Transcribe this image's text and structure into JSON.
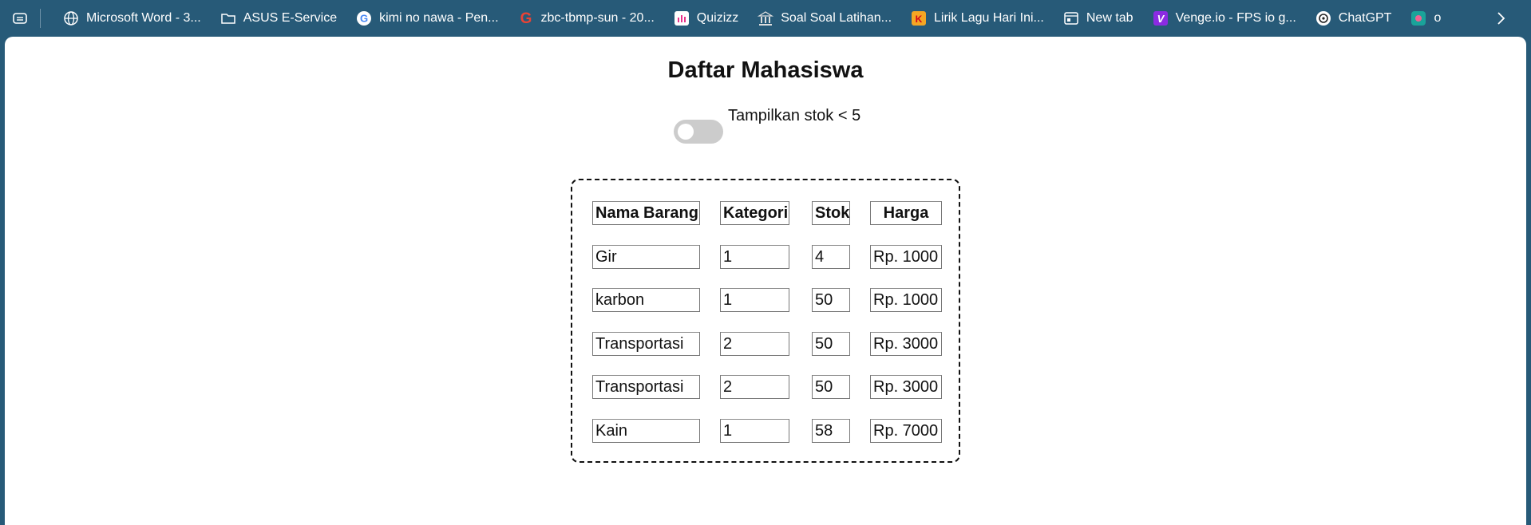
{
  "bookmarks": [
    {
      "label": "Microsoft Word - 3...",
      "icon": "globe-icon"
    },
    {
      "label": "ASUS E-Service",
      "icon": "folder-icon"
    },
    {
      "label": "kimi no nawa - Pen...",
      "icon": "google-icon"
    },
    {
      "label": "zbc-tbmp-sun - 20...",
      "icon": "google-icon"
    },
    {
      "label": "Quizizz",
      "icon": "quizizz-icon"
    },
    {
      "label": "Soal Soal Latihan...",
      "icon": "building-icon"
    },
    {
      "label": "Lirik Lagu Hari Ini...",
      "icon": "lirik-icon"
    },
    {
      "label": "New tab",
      "icon": "new-tab-icon"
    },
    {
      "label": "Venge.io - FPS io g...",
      "icon": "venge-icon"
    },
    {
      "label": "ChatGPT",
      "icon": "chatgpt-icon"
    },
    {
      "label": "o",
      "icon": "app-icon"
    }
  ],
  "page": {
    "title": "Daftar Mahasiswa",
    "toggle_label": "Tampilkan stok < 5",
    "toggle_on": false
  },
  "table": {
    "headers": [
      "Nama Barang",
      "Kategori",
      "Stok",
      "Harga"
    ],
    "rows": [
      [
        "Gir",
        "1",
        "4",
        "Rp. 1000"
      ],
      [
        "karbon",
        "1",
        "50",
        "Rp. 1000"
      ],
      [
        "Transportasi",
        "2",
        "50",
        "Rp. 3000"
      ],
      [
        "Transportasi",
        "2",
        "50",
        "Rp. 3000"
      ],
      [
        "Kain",
        "1",
        "58",
        "Rp. 7000"
      ]
    ]
  },
  "colors": {
    "toolbar_bg": "#275a78",
    "toggle_off": "#cccccc"
  }
}
